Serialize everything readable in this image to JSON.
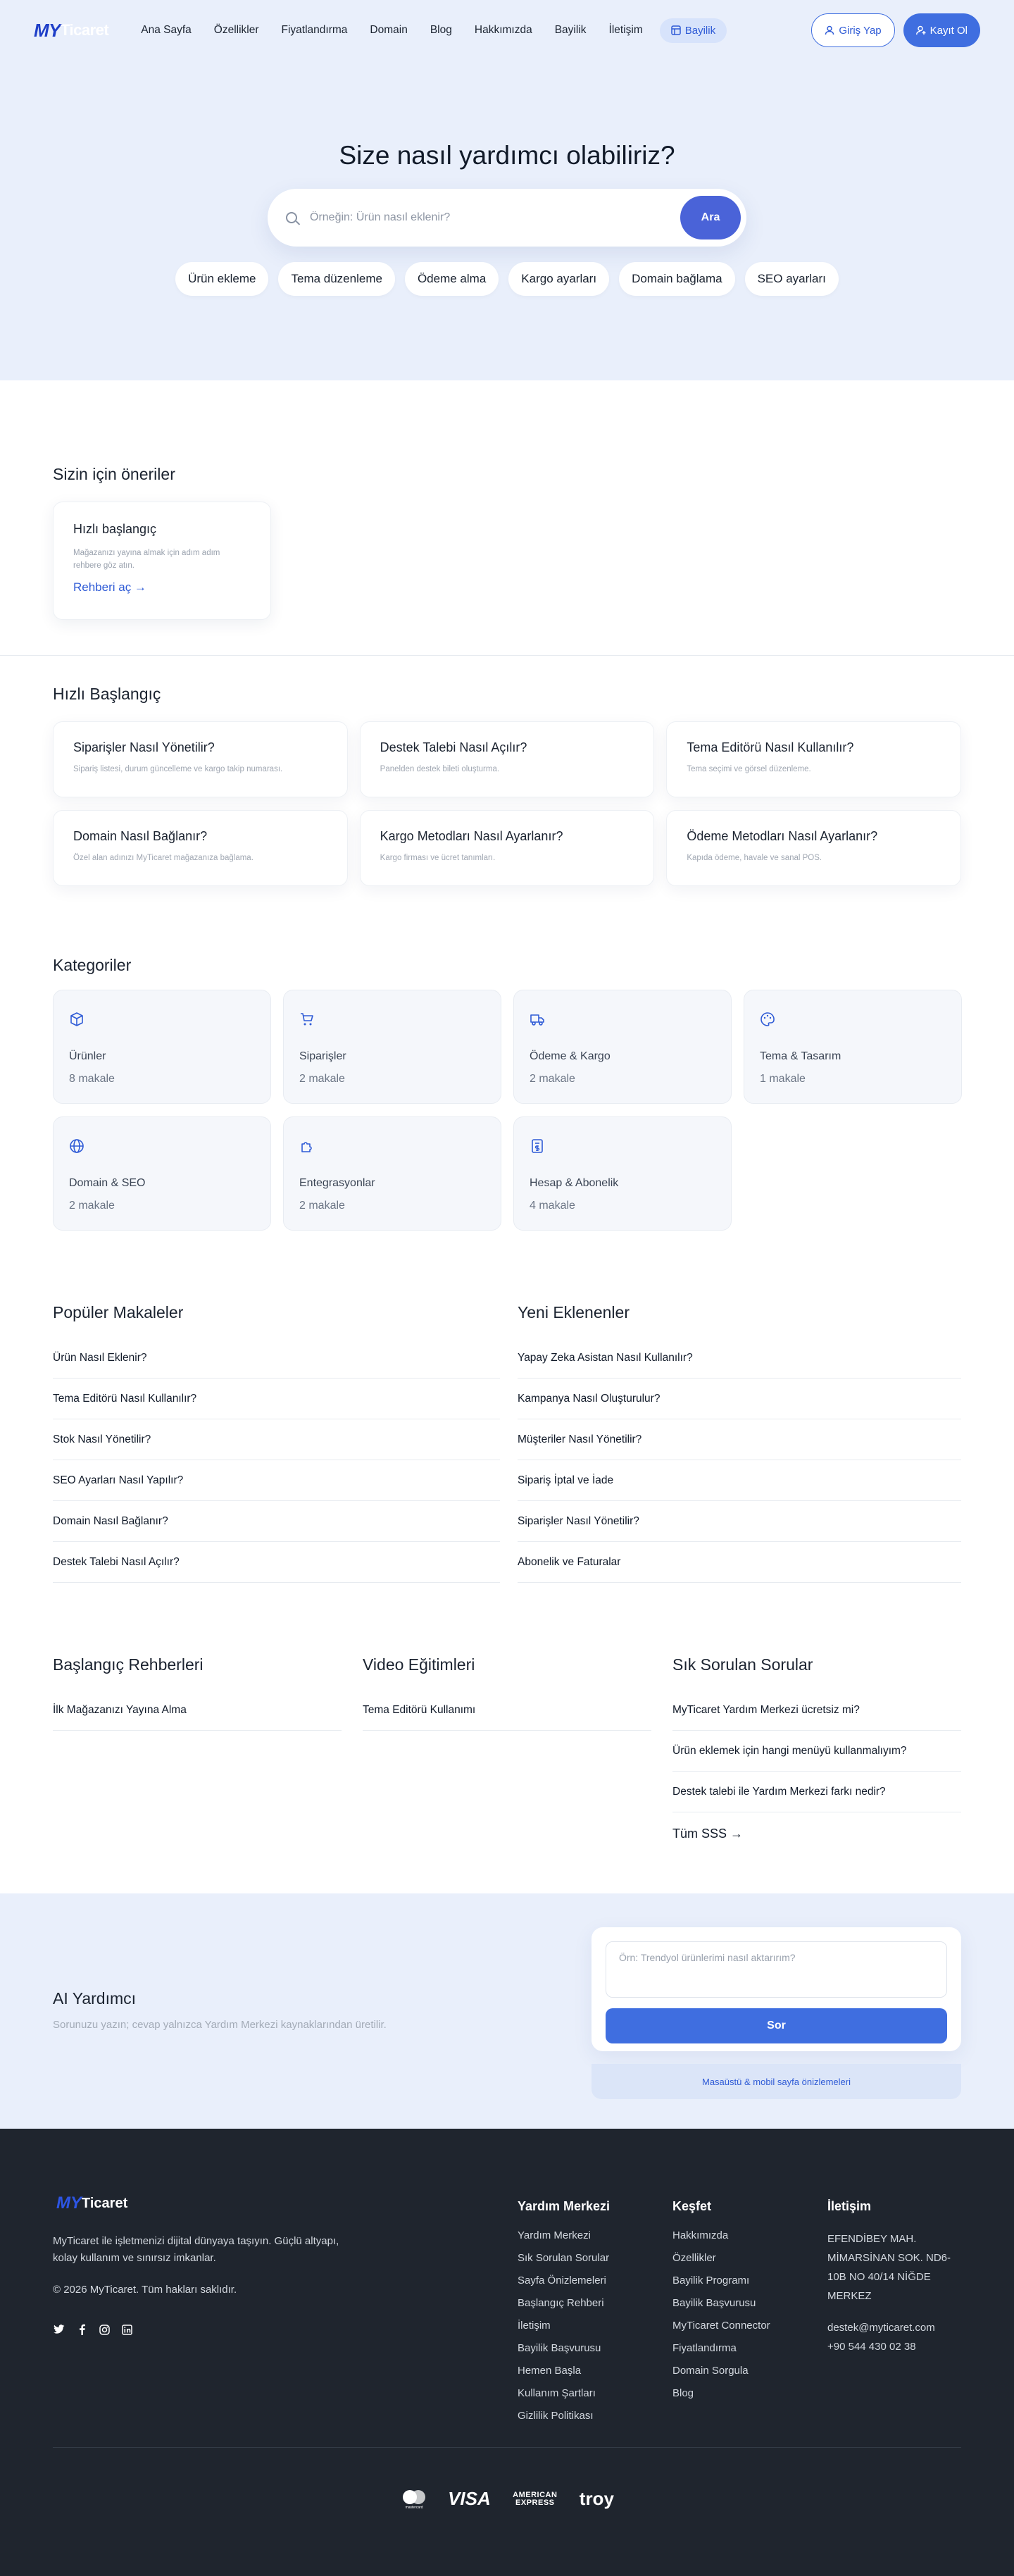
{
  "header": {
    "logo_my": "MY",
    "logo_rest": "Ticaret",
    "nav": [
      "Ana Sayfa",
      "Özellikler",
      "Fiyatlandırma",
      "Domain",
      "Blog",
      "Hakkımızda",
      "Bayilik",
      "İletişim"
    ],
    "bayilik_pill": "Bayilik",
    "login": "Giriş Yap",
    "register": "Kayıt Ol"
  },
  "hero": {
    "title": "Size nasıl yardımcı olabiliriz?",
    "search_placeholder": "Örneğin: Ürün nasıl eklenir?",
    "search_button": "Ara",
    "chips": [
      "Ürün ekleme",
      "Tema düzenleme",
      "Ödeme alma",
      "Kargo ayarları",
      "Domain bağlama",
      "SEO ayarları"
    ]
  },
  "recommendations": {
    "title": "Sizin için öneriler",
    "card": {
      "title": "Hızlı başlangıç",
      "desc": "Mağazanızı yayına almak için adım adım rehbere göz atın.",
      "link": "Rehberi aç →"
    }
  },
  "quick_start": {
    "title": "Hızlı Başlangıç",
    "items": [
      {
        "title": "Siparişler Nasıl Yönetilir?",
        "desc": "Sipariş listesi, durum güncelleme ve kargo takip numarası."
      },
      {
        "title": "Destek Talebi Nasıl Açılır?",
        "desc": "Panelden destek bileti oluşturma."
      },
      {
        "title": "Tema Editörü Nasıl Kullanılır?",
        "desc": "Tema seçimi ve görsel düzenleme."
      },
      {
        "title": "Domain Nasıl Bağlanır?",
        "desc": "Özel alan adınızı MyTicaret mağazanıza bağlama."
      },
      {
        "title": "Kargo Metodları Nasıl Ayarlanır?",
        "desc": "Kargo firması ve ücret tanımları."
      },
      {
        "title": "Ödeme Metodları Nasıl Ayarlanır?",
        "desc": "Kapıda ödeme, havale ve sanal POS."
      }
    ]
  },
  "categories": {
    "title": "Kategoriler",
    "items": [
      {
        "name": "Ürünler",
        "count": "8 makale",
        "icon": "box-icon"
      },
      {
        "name": "Siparişler",
        "count": "2 makale",
        "icon": "cart-icon"
      },
      {
        "name": "Ödeme & Kargo",
        "count": "2 makale",
        "icon": "truck-icon"
      },
      {
        "name": "Tema & Tasarım",
        "count": "1 makale",
        "icon": "palette-icon"
      },
      {
        "name": "Domain & SEO",
        "count": "2 makale",
        "icon": "globe-icon"
      },
      {
        "name": "Entegrasyonlar",
        "count": "2 makale",
        "icon": "puzzle-icon"
      },
      {
        "name": "Hesap & Abonelik",
        "count": "4 makale",
        "icon": "invoice-icon"
      }
    ]
  },
  "popular": {
    "title": "Popüler Makaleler",
    "items": [
      "Ürün Nasıl Eklenir?",
      "Tema Editörü Nasıl Kullanılır?",
      "Stok Nasıl Yönetilir?",
      "SEO Ayarları Nasıl Yapılır?",
      "Domain Nasıl Bağlanır?",
      "Destek Talebi Nasıl Açılır?"
    ]
  },
  "recent": {
    "title": "Yeni Eklenenler",
    "items": [
      "Yapay Zeka Asistan Nasıl Kullanılır?",
      "Kampanya Nasıl Oluşturulur?",
      "Müşteriler Nasıl Yönetilir?",
      "Sipariş İptal ve İade",
      "Siparişler Nasıl Yönetilir?",
      "Abonelik ve Faturalar"
    ]
  },
  "guides": {
    "title": "Başlangıç Rehberleri",
    "items": [
      "İlk Mağazanızı Yayına Alma"
    ]
  },
  "videos": {
    "title": "Video Eğitimleri",
    "items": [
      "Tema Editörü Kullanımı"
    ]
  },
  "faq": {
    "title": "Sık Sorulan Sorular",
    "items": [
      "MyTicaret Yardım Merkezi ücretsiz mi?",
      "Ürün eklemek için hangi menüyü kullanmalıyım?",
      "Destek talebi ile Yardım Merkezi farkı nedir?"
    ],
    "all": "Tüm SSS →"
  },
  "ai": {
    "title": "AI Yardımcı",
    "desc": "Sorunuzu yazın; cevap yalnızca Yardım Merkezi kaynaklarından üretilir.",
    "placeholder": "Örn: Trendyol ürünlerimi nasıl aktarırım?",
    "button": "Sor",
    "preview_link": "Masaüstü & mobil sayfa önizlemeleri"
  },
  "footer": {
    "logo_my": "MY",
    "logo_rest": "Ticaret",
    "desc": "MyTicaret ile işletmenizi dijital dünyaya taşıyın. Güçlü altyapı, kolay kullanım ve sınırsız imkanlar.",
    "copyright": "© 2026 MyTicaret. Tüm hakları saklıdır.",
    "help": {
      "title": "Yardım Merkezi",
      "items": [
        "Yardım Merkezi",
        "Sık Sorulan Sorular",
        "Sayfa Önizlemeleri",
        "Başlangıç Rehberi",
        "İletişim",
        "Bayilik Başvurusu",
        "Hemen Başla",
        "Kullanım Şartları",
        "Gizlilik Politikası"
      ]
    },
    "explore": {
      "title": "Keşfet",
      "items": [
        "Hakkımızda",
        "Özellikler",
        "Bayilik Programı",
        "Bayilik Başvurusu",
        "MyTicaret Connector",
        "Fiyatlandırma",
        "Domain Sorgula",
        "Blog"
      ]
    },
    "contact": {
      "title": "İletişim",
      "address": "EFENDİBEY MAH. MİMARSİNAN SOK. ND6-10B NO 40/14 NİĞDE MERKEZ",
      "email": "destek@myticaret.com",
      "phone": "+90 544 430 02 38"
    },
    "payments": {
      "visa": "VISA",
      "amex": "AMERICAN EXPRESS",
      "troy": "troy",
      "mc": "mastercard"
    }
  }
}
